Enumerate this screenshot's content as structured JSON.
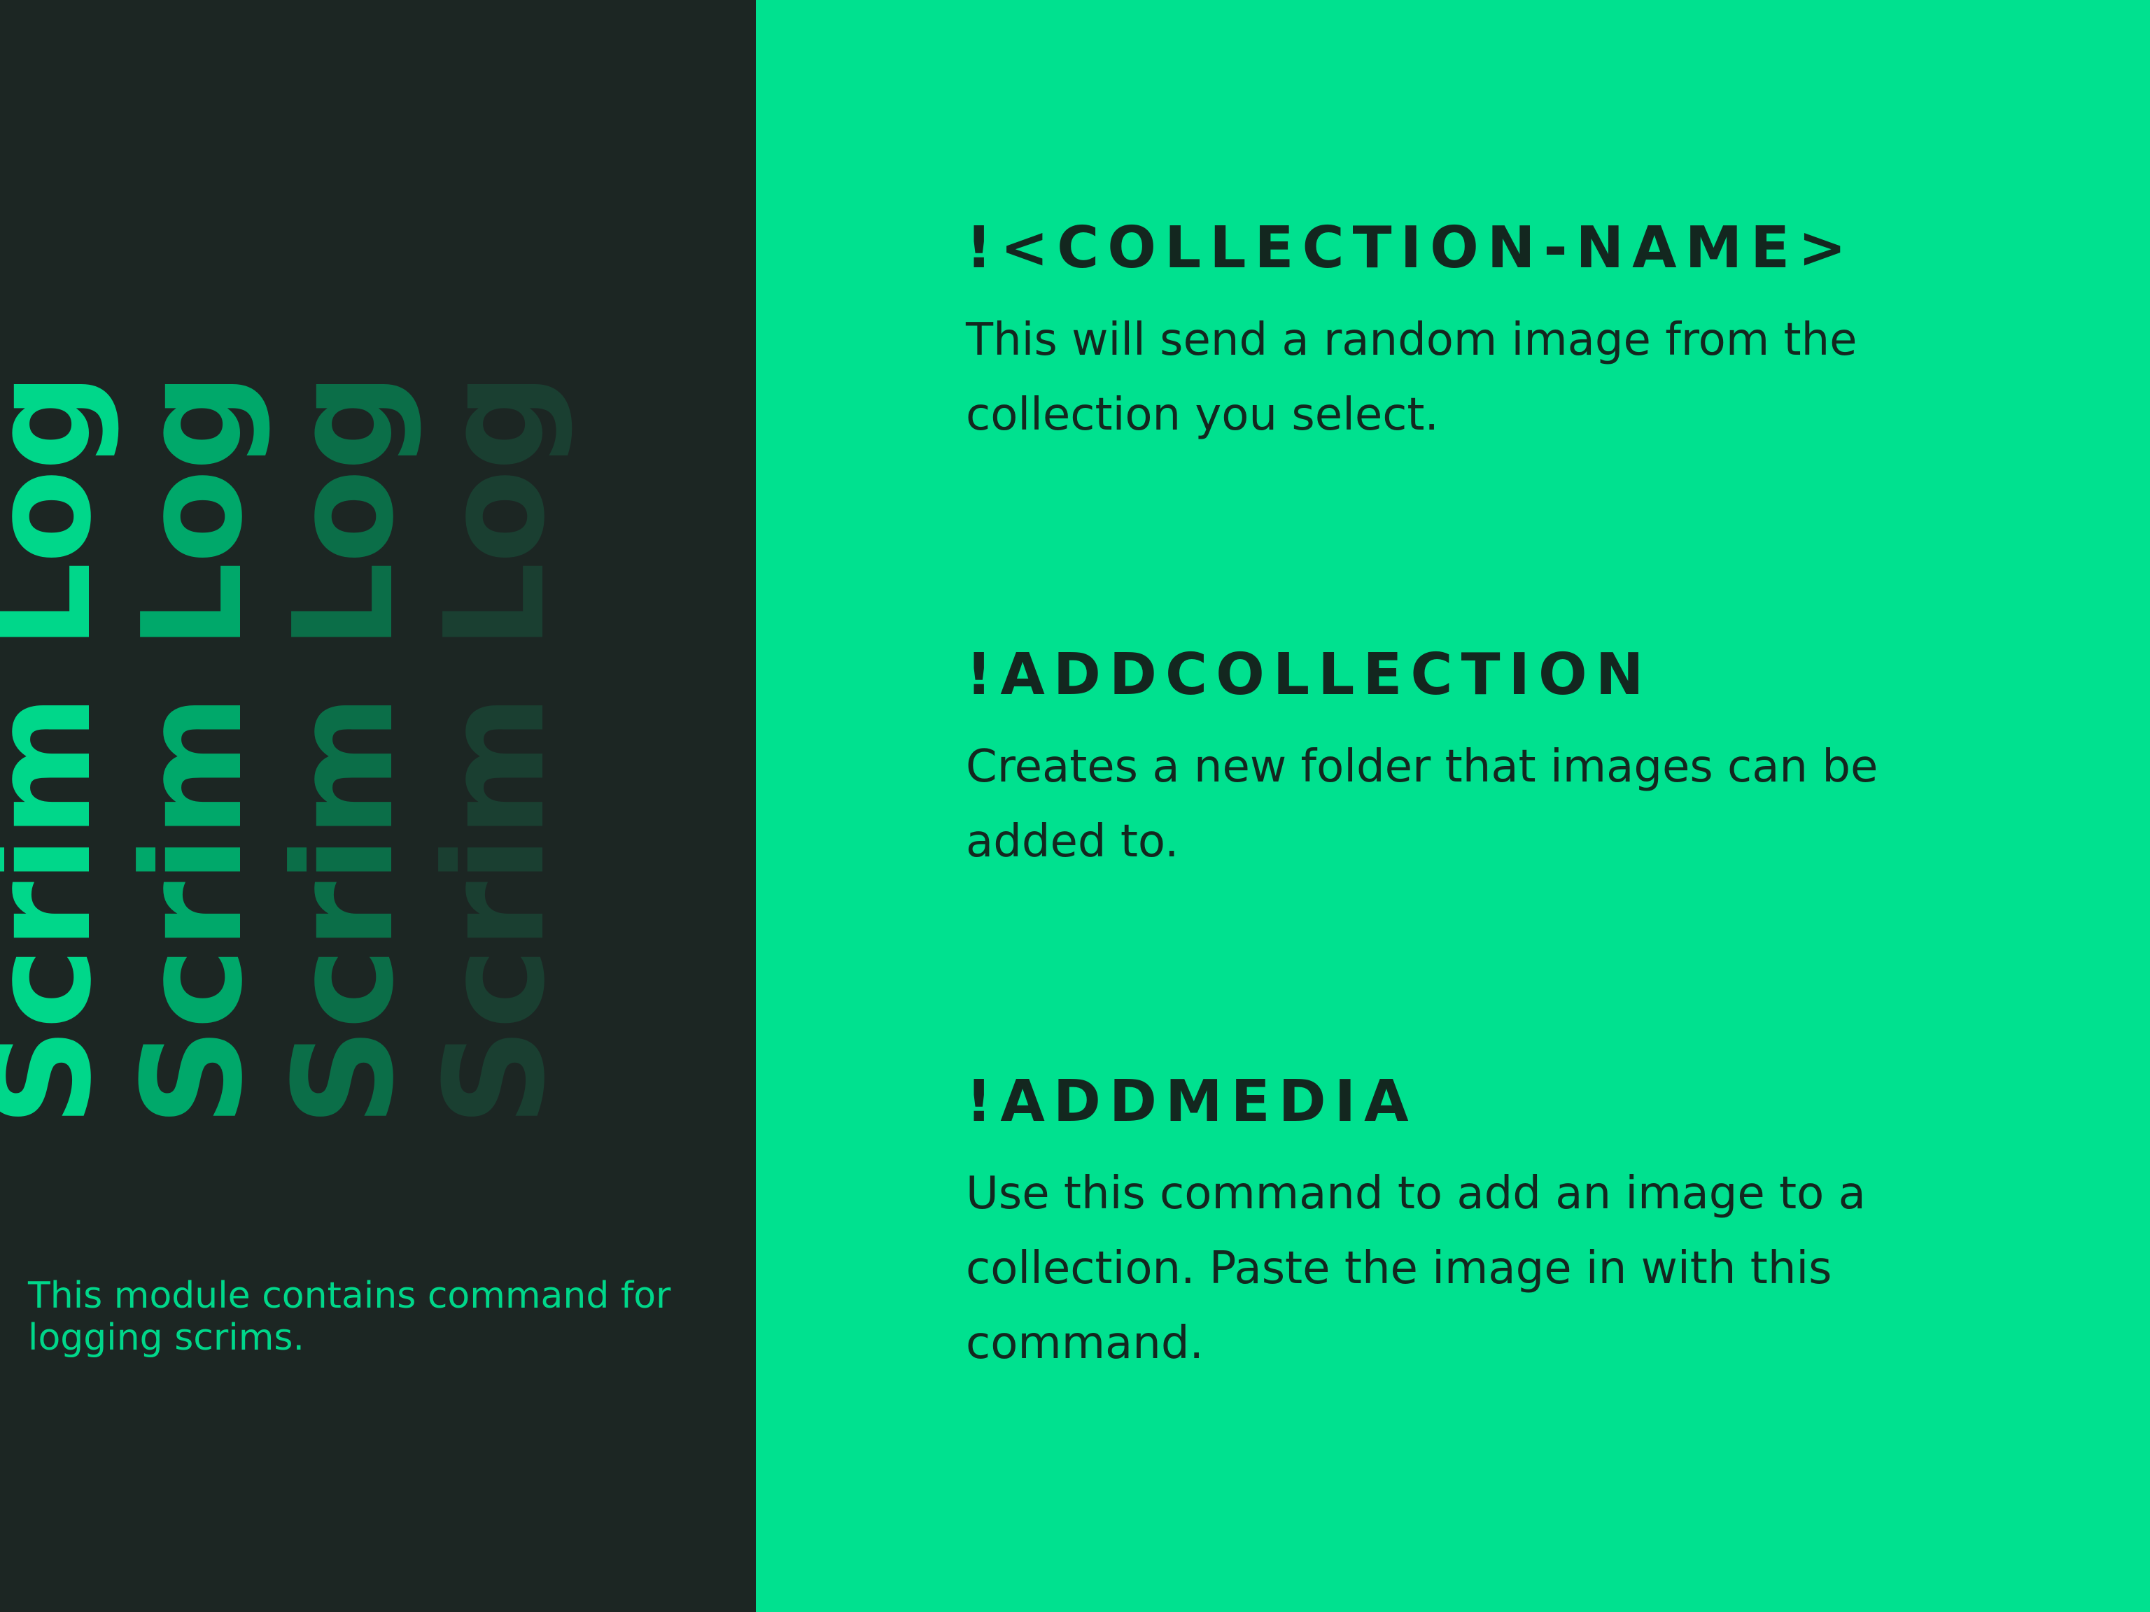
{
  "module": {
    "title": "Scrim Log",
    "description": "This module contains command for logging scrims."
  },
  "commands": [
    {
      "name": "!<COLLECTION-NAME>",
      "description": "This will send a random image from the collection you select."
    },
    {
      "name": "!ADDCOLLECTION",
      "description": "Creates a new folder that images can be added to."
    },
    {
      "name": "!ADDMEDIA",
      "description": "Use this command to add an image to a collection. Paste the image in with this command."
    }
  ],
  "colors": {
    "dark_background": "#1c2623",
    "accent_green": "#00e18f",
    "title_shades": [
      "#00d78a",
      "#00a86a",
      "#0b6e48",
      "#1a3f31"
    ],
    "body_text_dark": "#13271f"
  }
}
